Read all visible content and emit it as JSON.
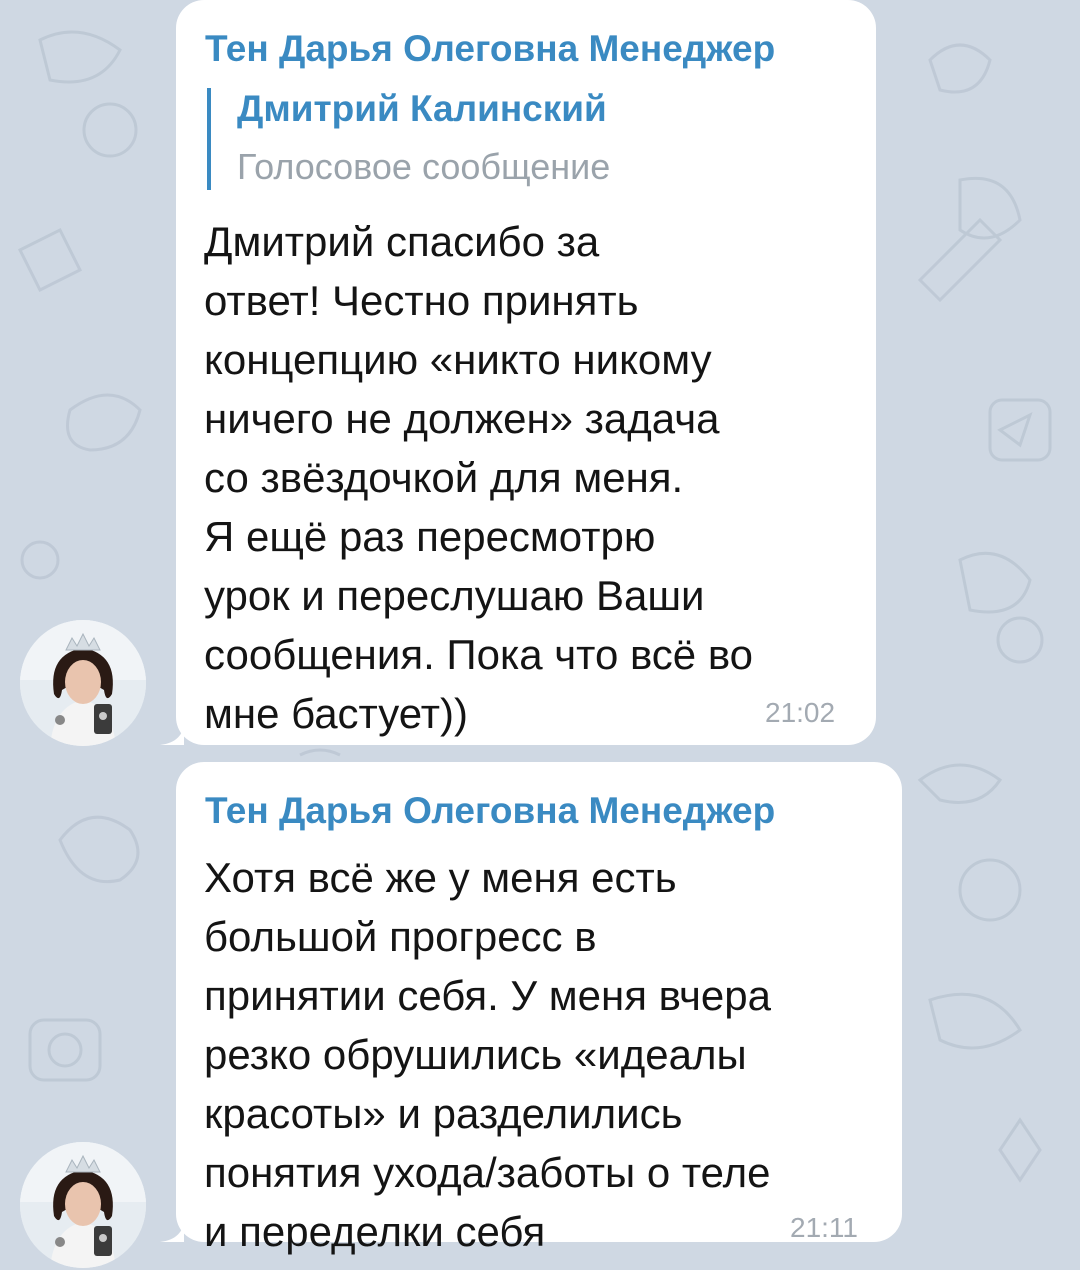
{
  "chat": {
    "background_color": "#cfd8e3",
    "messages": [
      {
        "sender": "Тен Дарья Олеговна Менеджер",
        "reply": {
          "author": "Дмитрий Калинский",
          "text": "Голосовое сообщение"
        },
        "text": "Дмитрий спасибо за\nответ! Честно принять\nконцепцию «никто никому\nничего не должен» задача\nсо звёздочкой для меня.\nЯ ещё раз пересмотрю\nурок и переслушаю Ваши\nсообщения. Пока что всё во\nмне бастует))",
        "time": "21:02"
      },
      {
        "sender": "Тен Дарья Олеговна Менеджер",
        "text": "Хотя всё же у меня есть\nбольшой прогресс в\nпринятии себя. У меня вчера\nрезко обрушились «идеалы\nкрасоты» и разделились\nпонятия ухода/заботы о теле\nи переделки себя",
        "time": "21:11"
      }
    ]
  },
  "colors": {
    "accent": "#3a8ac2",
    "bubble": "#ffffff",
    "text": "#141414",
    "muted": "#9aa3ab"
  },
  "icons": {
    "avatar": "user-photo-avatar"
  }
}
